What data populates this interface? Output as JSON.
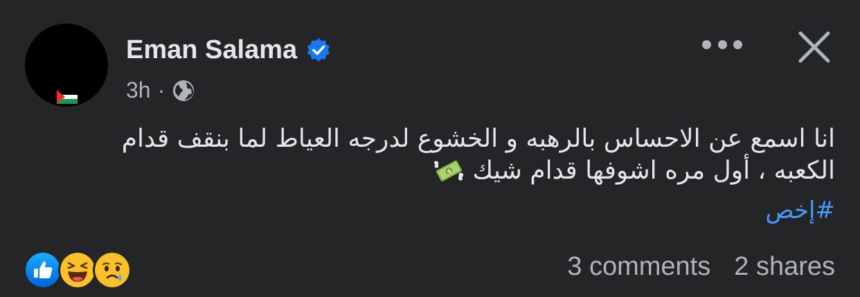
{
  "post": {
    "author": "Eman Salama",
    "time": "3h",
    "separator": "·",
    "text_line1": "انا اسمع عن الاحساس بالرهبه و الخشوع لدرجه العياط لما بنقف قدام",
    "text_line2": "الكعبه ، أول مره اشوفها قدام شيك",
    "hashtag": "#إخص"
  },
  "icons": {
    "verified": "verified-badge-icon",
    "audience": "globe-icon",
    "more": "more-options-icon",
    "close": "close-icon",
    "flag": "palestine-flag-icon",
    "emoji": "money-with-wings-emoji",
    "reactions": [
      "like-reaction-icon",
      "haha-reaction-icon",
      "sad-reaction-icon"
    ]
  },
  "footer": {
    "comments": "3 comments",
    "shares": "2 shares"
  },
  "colors": {
    "background": "#242526",
    "primary_text": "#e4e6eb",
    "secondary_text": "#b0b3b8",
    "link": "#4599ff",
    "verified_blue": "#1877f2"
  }
}
